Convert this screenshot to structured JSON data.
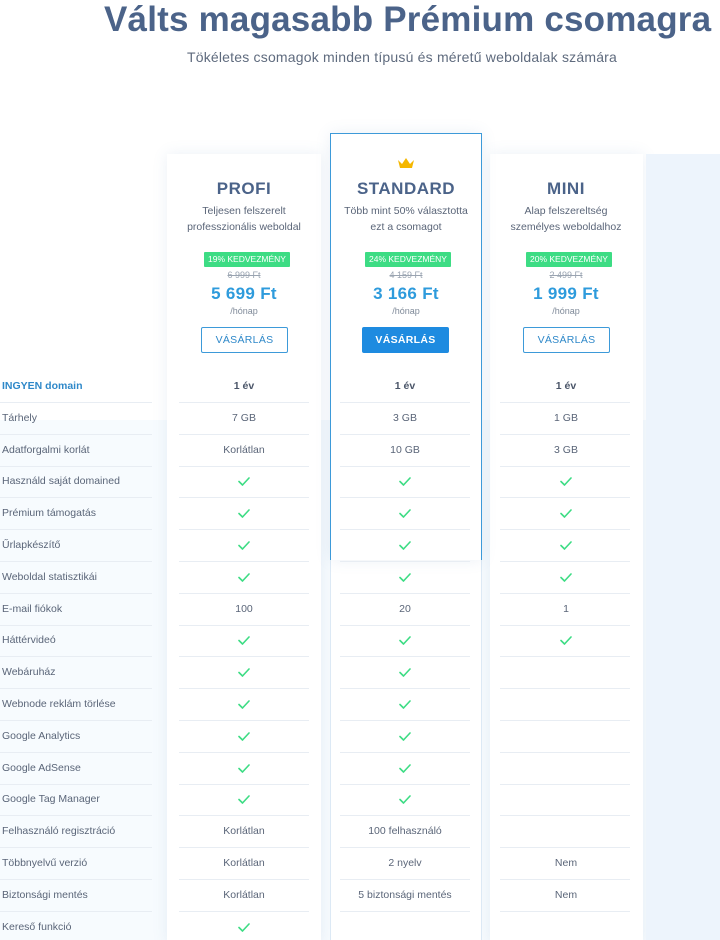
{
  "header": {
    "title": "Válts magasabb Prémium csomagra",
    "subtitle": "Tökéletes csomagok minden típusú és méretű weboldalak számára"
  },
  "plans": [
    {
      "name": "PROFI",
      "desc_line1": "Teljesen felszerelt",
      "desc_line2": "professzionális weboldal",
      "badge": "19% KEDVEZMÉNY",
      "old_price": "6 999 Ft",
      "price": "5 699 Ft",
      "per": "/hónap",
      "button": "VÁSÁRLÁS"
    },
    {
      "name": "STANDARD",
      "desc_line1": "Több mint 50% választotta",
      "desc_line2": "ezt a csomagot",
      "badge": "24% KEDVEZMÉNY",
      "old_price": "4 159 Ft",
      "price": "3 166 Ft",
      "per": "/hónap",
      "button": "VÁSÁRLÁS",
      "crown_icon": "crown-icon",
      "crown_color": "#f5b700"
    },
    {
      "name": "MINI",
      "desc_line1": "Alap felszereltség",
      "desc_line2": "személyes weboldalhoz",
      "badge": "20% KEDVEZMÉNY",
      "old_price": "2 499 Ft",
      "price": "1 999 Ft",
      "per": "/hónap",
      "button": "VÁSÁRLÁS"
    }
  ],
  "features": [
    {
      "label": "INGYEN domain",
      "profi": "1 év",
      "standard": "1 év",
      "mini": "1 év"
    },
    {
      "label": "Tárhely",
      "profi": "7 GB",
      "standard": "3 GB",
      "mini": "1 GB"
    },
    {
      "label": "Adatforgalmi korlát",
      "profi": "Korlátlan",
      "standard": "10 GB",
      "mini": "3 GB"
    },
    {
      "label": "Használd saját domained",
      "profi": "check",
      "standard": "check",
      "mini": "check"
    },
    {
      "label": "Prémium támogatás",
      "profi": "check",
      "standard": "check",
      "mini": "check"
    },
    {
      "label": "Űrlapkészítő",
      "profi": "check",
      "standard": "check",
      "mini": "check"
    },
    {
      "label": "Weboldal statisztikái",
      "profi": "check",
      "standard": "check",
      "mini": "check"
    },
    {
      "label": "E-mail fiókok",
      "profi": "100",
      "standard": "20",
      "mini": "1"
    },
    {
      "label": "Háttérvideó",
      "profi": "check",
      "standard": "check",
      "mini": "check"
    },
    {
      "label": "Webáruház",
      "profi": "check",
      "standard": "check",
      "mini": ""
    },
    {
      "label": "Webnode reklám törlése",
      "profi": "check",
      "standard": "check",
      "mini": ""
    },
    {
      "label": "Google Analytics",
      "profi": "check",
      "standard": "check",
      "mini": ""
    },
    {
      "label": "Google AdSense",
      "profi": "check",
      "standard": "check",
      "mini": ""
    },
    {
      "label": "Google Tag Manager",
      "profi": "check",
      "standard": "check",
      "mini": ""
    },
    {
      "label": "Felhasználó regisztráció",
      "profi": "Korlátlan",
      "standard": "100 felhasználó",
      "mini": ""
    },
    {
      "label": "Többnyelvű verzió",
      "profi": "Korlátlan",
      "standard": "2 nyelv",
      "mini": "Nem"
    },
    {
      "label": "Biztonsági mentés",
      "profi": "Korlátlan",
      "standard": "5 biztonsági mentés",
      "mini": "Nem"
    },
    {
      "label": "Kereső funkció",
      "profi": "check",
      "standard": "",
      "mini": ""
    }
  ],
  "colors": {
    "title": "#4b6389",
    "accent": "#1e8be0",
    "price": "#2e9bdc",
    "badge": "#3ddc84",
    "check": "#3ddc84"
  }
}
